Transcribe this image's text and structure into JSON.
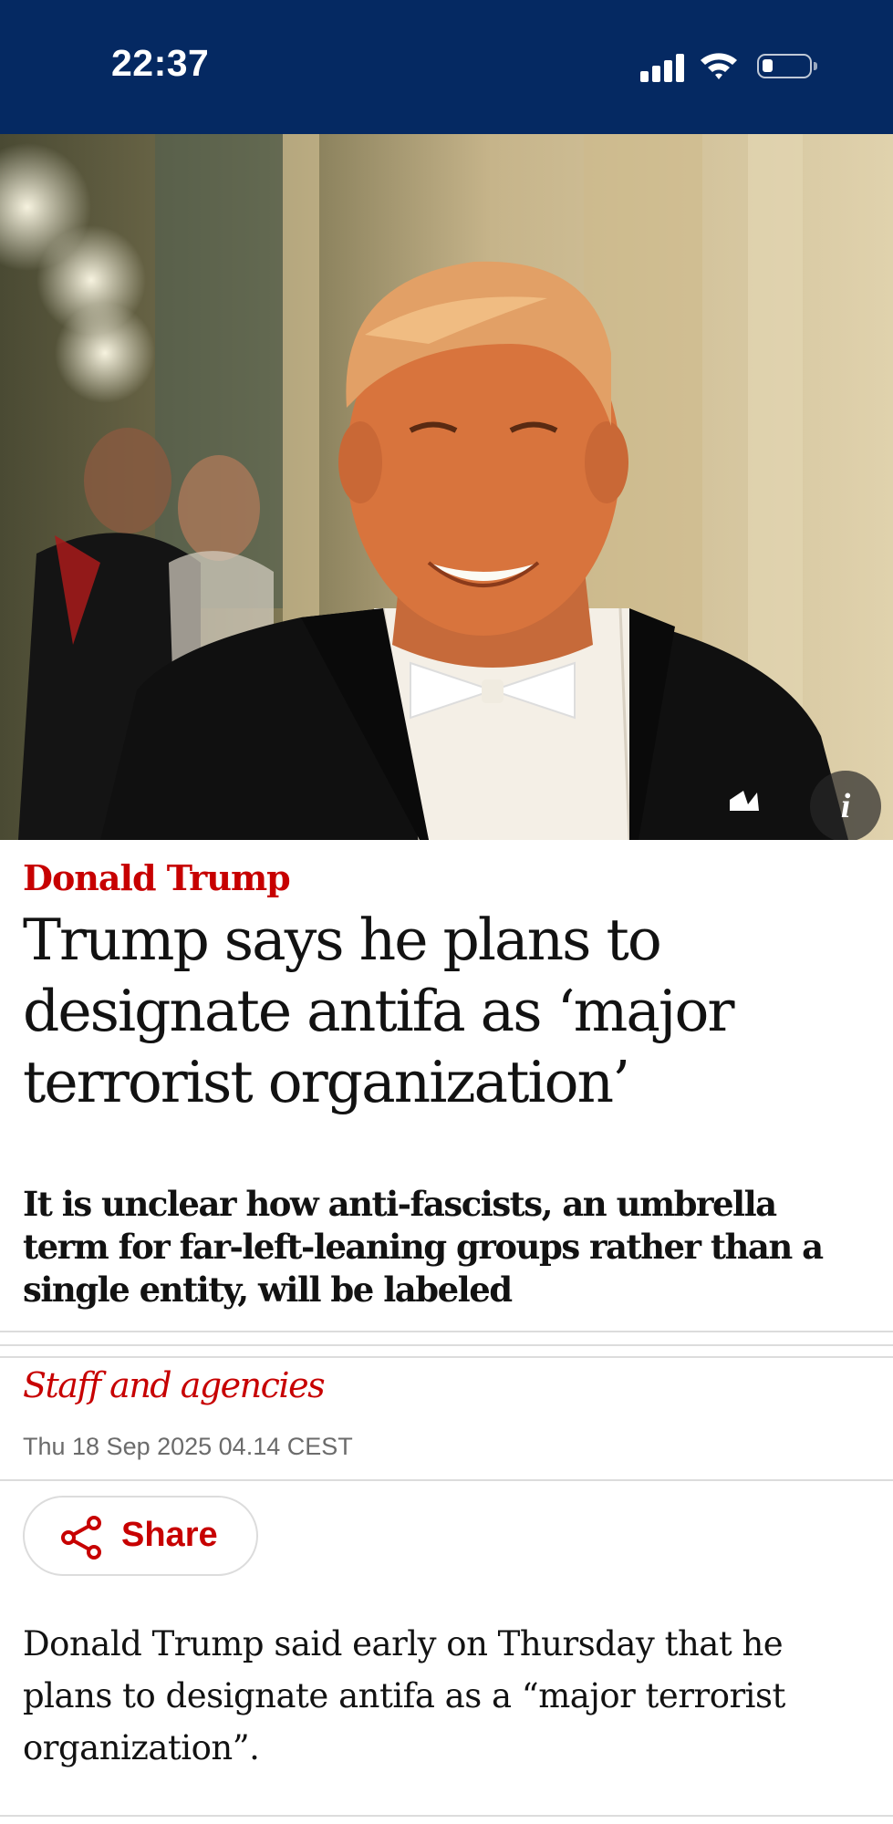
{
  "status_bar": {
    "time": "22:37",
    "icons": [
      "cellular-signal-icon",
      "wifi-icon",
      "battery-icon"
    ]
  },
  "hero_image": {
    "info_label": "i"
  },
  "article": {
    "section": "Donald Trump",
    "headline": "Trump says he plans to designate antifa as ‘major terrorist organization’",
    "standfirst": "It is unclear how anti-fascists, an umbrella term for far-left-leaning groups rather than a single entity, will be labeled",
    "byline": "Staff and agencies",
    "date": "Thu 18 Sep 2025 04.14 CEST",
    "share_label": "Share",
    "body": "Donald Trump said early on Thursday that he plans to designate antifa as a “major terrorist organization”."
  },
  "colors": {
    "header_blue": "#052962",
    "accent_red": "#c70000",
    "text": "#121212",
    "meta_grey": "#6b6b6b"
  }
}
